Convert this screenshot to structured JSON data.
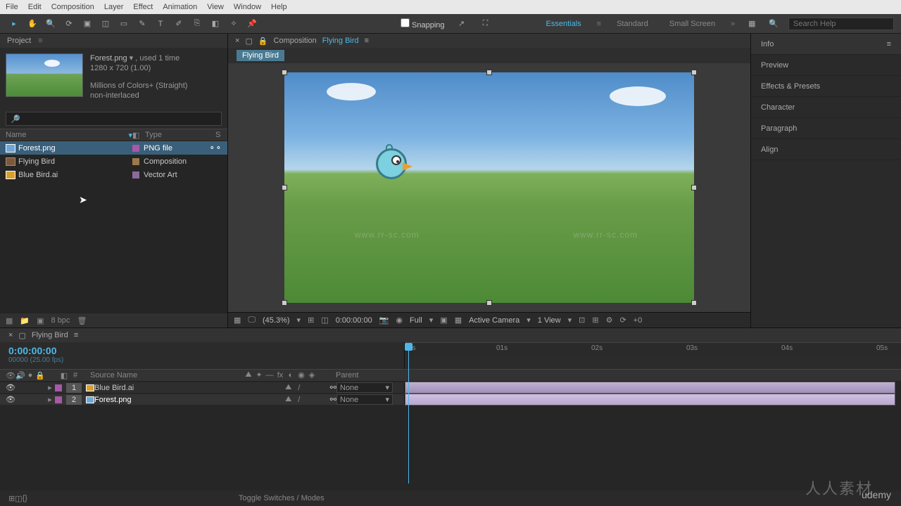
{
  "menubar": [
    "File",
    "Edit",
    "Composition",
    "Layer",
    "Effect",
    "Animation",
    "View",
    "Window",
    "Help"
  ],
  "toolbar": {
    "snapping": "Snapping",
    "workspaces": [
      "Essentials",
      "Standard",
      "Small Screen"
    ],
    "active_workspace": "Essentials",
    "search_placeholder": "Search Help"
  },
  "project": {
    "panel_title": "Project",
    "selected_asset": {
      "name": "Forest.png",
      "usage": ", used 1 time",
      "dims": "1280 x 720 (1.00)",
      "colors": "Millions of Colors+ (Straight)",
      "interlace": "non-interlaced"
    },
    "columns": {
      "name": "Name",
      "type": "Type",
      "size": "S"
    },
    "items": [
      {
        "name": "Forest.png",
        "type": "PNG file",
        "icon": "png",
        "sw": "sw-png",
        "selected": true
      },
      {
        "name": "Flying Bird",
        "type": "Composition",
        "icon": "comp",
        "sw": "sw-comp",
        "selected": false
      },
      {
        "name": "Blue Bird.ai",
        "type": "Vector Art",
        "icon": "ai",
        "sw": "sw-vec",
        "selected": false
      }
    ],
    "footer_bpc": "8 bpc"
  },
  "composition": {
    "tab_label": "Composition",
    "name": "Flying Bird",
    "breadcrumb": "Flying Bird",
    "viewer_footer": {
      "zoom": "(45.3%)",
      "timecode": "0:00:00:00",
      "resolution": "Full",
      "camera": "Active Camera",
      "views": "1 View",
      "exposure": "+0"
    }
  },
  "right_panels": [
    "Info",
    "Preview",
    "Effects & Presets",
    "Character",
    "Paragraph",
    "Align"
  ],
  "timeline": {
    "comp_name": "Flying Bird",
    "timecode": "0:00:00:00",
    "fps": "00000 (25.00 fps)",
    "columns": {
      "num": "#",
      "source": "Source Name",
      "parent": "Parent"
    },
    "ruler": [
      "0s",
      "01s",
      "02s",
      "03s",
      "04s",
      "05s"
    ],
    "layers": [
      {
        "num": "1",
        "name": "Blue Bird.ai",
        "icon": "ai",
        "parent": "None",
        "selected": false
      },
      {
        "num": "2",
        "name": "Forest.png",
        "icon": "png",
        "parent": "None",
        "selected": true
      }
    ],
    "toggle": "Toggle Switches / Modes"
  },
  "watermarks": {
    "site": "www.rr-sc.com",
    "brand": "人人素材",
    "udemy": "udemy"
  }
}
